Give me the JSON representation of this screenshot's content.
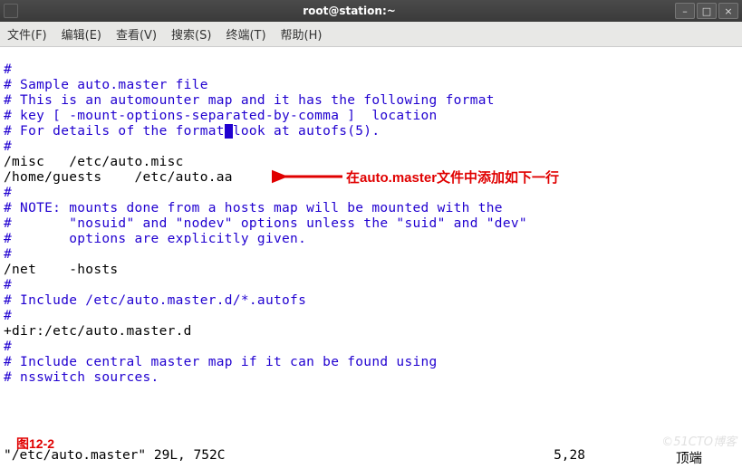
{
  "window": {
    "title": "root@station:~"
  },
  "menu": {
    "file": "文件(F)",
    "edit": "编辑(E)",
    "view": "查看(V)",
    "search": "搜索(S)",
    "terminal": "终端(T)",
    "help": "帮助(H)"
  },
  "content": {
    "l1": "#",
    "l2": "# Sample auto.master file",
    "l3": "# This is an automounter map and it has the following format",
    "l4": "# key [ -mount-options-separated-by-comma ]  location",
    "l5a": "# For details of the format",
    "l5b": "look at autofs(5).",
    "l6": "#",
    "l7": "/misc   /etc/auto.misc",
    "l8": "/home/guests    /etc/auto.aa",
    "l9": "#",
    "l10": "# NOTE: mounts done from a hosts map will be mounted with the",
    "l11": "#       \"nosuid\" and \"nodev\" options unless the \"suid\" and \"dev\"",
    "l12": "#       options are explicitly given.",
    "l13": "#",
    "l14": "/net    -hosts",
    "l15": "#",
    "l16": "# Include /etc/auto.master.d/*.autofs",
    "l17": "#",
    "l18": "+dir:/etc/auto.master.d",
    "l19": "#",
    "l20": "# Include central master map if it can be found using",
    "l21": "# nsswitch sources."
  },
  "annotation": {
    "text": "在auto.master文件中添加如下一行"
  },
  "figure": {
    "label": "图12-2"
  },
  "status": {
    "left": "\"/etc/auto.master\" 29L, 752C",
    "pos": "5,28",
    "right": "顶端"
  },
  "watermark": "©51CTO博客"
}
